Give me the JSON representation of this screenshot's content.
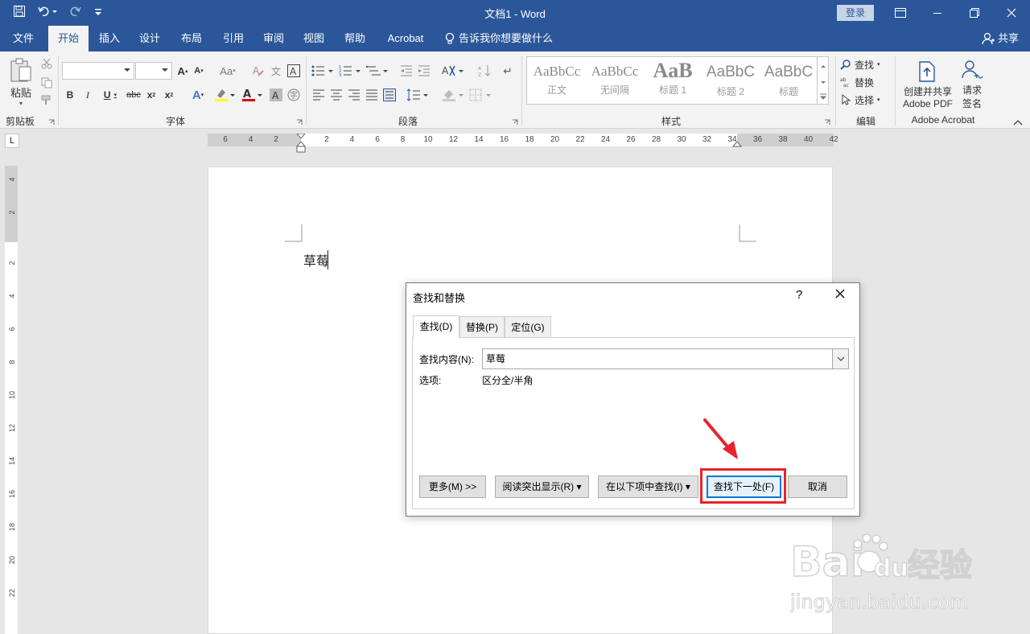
{
  "titlebar": {
    "title": "文档1  -  Word",
    "login": "登录"
  },
  "tabs": [
    "文件",
    "开始",
    "插入",
    "设计",
    "布局",
    "引用",
    "审阅",
    "视图",
    "帮助",
    "Acrobat"
  ],
  "active_tab": "开始",
  "tell_me": "告诉我你想要做什么",
  "share": "共享",
  "ribbon": {
    "clipboard": {
      "paste": "粘贴",
      "label": "剪贴板"
    },
    "font": {
      "label": "字体"
    },
    "paragraph": {
      "label": "段落"
    },
    "styles": {
      "label": "样式",
      "items": [
        {
          "sample": "AaBbCc",
          "name": "正文"
        },
        {
          "sample": "AaBbCc",
          "name": "无间隔"
        },
        {
          "sample": "AaB",
          "name": "标题 1"
        },
        {
          "sample": "AaBbC",
          "name": "标题 2"
        },
        {
          "sample": "AaBbC",
          "name": "标题"
        }
      ]
    },
    "editing": {
      "find": "查找",
      "replace": "替换",
      "select": "选择",
      "label": "编辑"
    },
    "acrobat": {
      "create": "创建并共享",
      "create2": "Adobe PDF",
      "request": "请求",
      "request2": "签名",
      "label": "Adobe Acrobat"
    }
  },
  "ruler": {
    "corner": "L",
    "h_ticks": [
      "6",
      "4",
      "2",
      "2",
      "4",
      "6",
      "8",
      "10",
      "12",
      "14",
      "16",
      "18",
      "20",
      "22",
      "24",
      "26",
      "28",
      "30",
      "32",
      "34",
      "36",
      "38",
      "40",
      "42"
    ],
    "v_ticks": [
      "4",
      "2",
      "2",
      "4",
      "6",
      "8",
      "10",
      "12",
      "14",
      "16",
      "18",
      "20",
      "22"
    ]
  },
  "document": {
    "text": "草莓"
  },
  "dialog": {
    "title": "查找和替换",
    "help": "?",
    "tabs": [
      "查找(D)",
      "替换(P)",
      "定位(G)"
    ],
    "find_label": "查找内容(N):",
    "find_value": "草莓",
    "options_label": "选项:",
    "options_value": "区分全/半角",
    "buttons": {
      "more": "更多(M) >>",
      "reading_highlight": "阅读突出显示(R) ▾",
      "find_in": "在以下项中查找(I) ▾",
      "find_next": "查找下一处(F)",
      "cancel": "取消"
    }
  },
  "watermark": {
    "logo": "Baidu经验",
    "url": "jingyan.baidu.com"
  },
  "colors": {
    "accent": "#2b579a",
    "highlight": "#e8232b"
  }
}
